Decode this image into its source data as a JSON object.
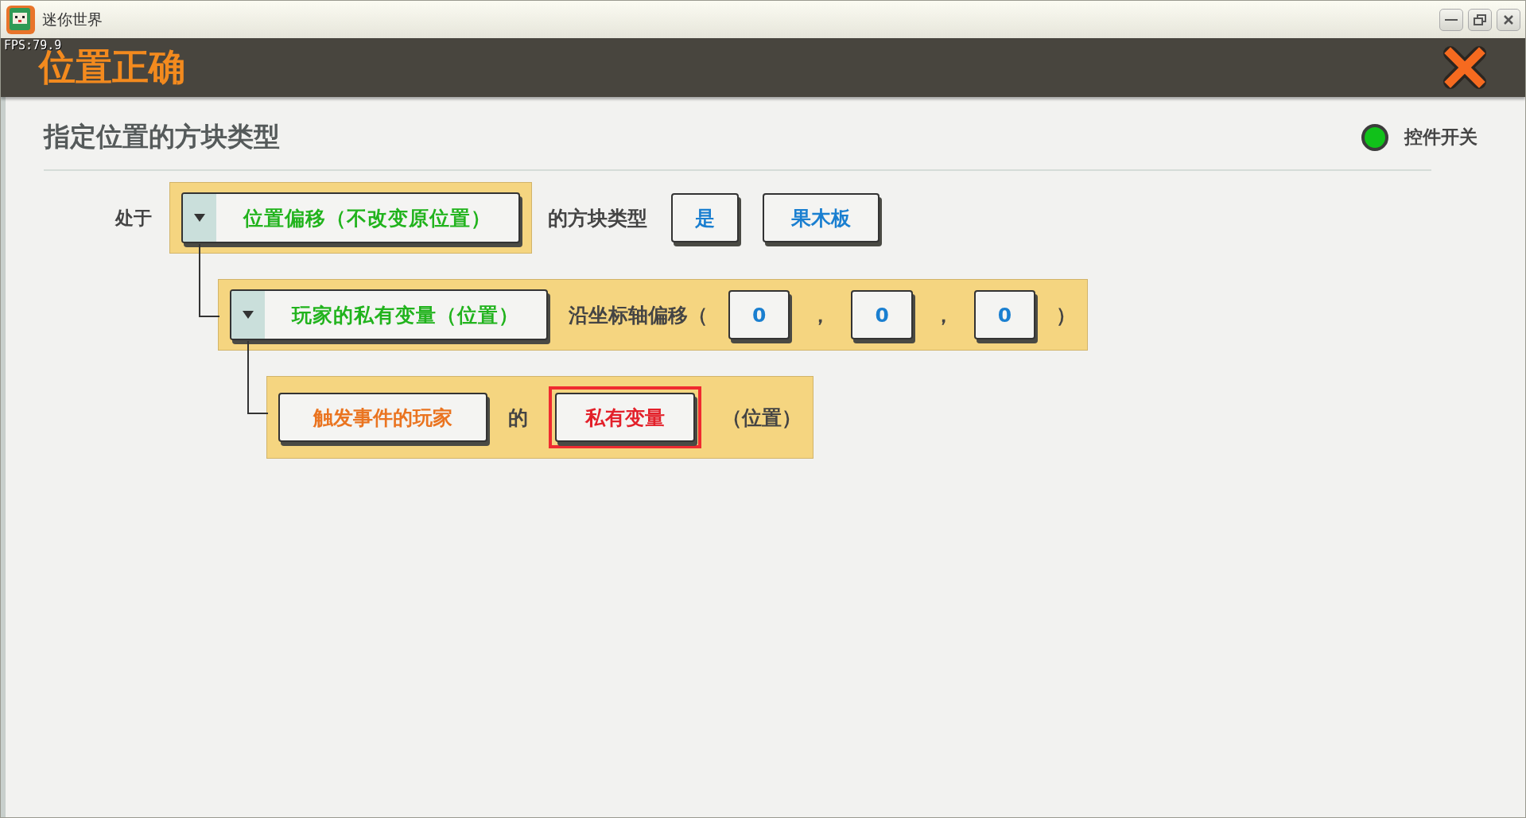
{
  "window": {
    "title": "迷你世界",
    "fps": "FPS:79.9"
  },
  "header": {
    "title": "位置正确"
  },
  "section": {
    "title": "指定位置的方块类型",
    "toggle": {
      "label": "控件开关",
      "on": true
    }
  },
  "statement": {
    "lead": "处于",
    "block": {
      "dropdown": "位置偏移（不改变原位置）",
      "child": {
        "dropdown": "玩家的私有变量（位置）",
        "items": [
          {
            "kind": "text",
            "text": "沿坐标轴偏移（"
          },
          {
            "kind": "value",
            "text": "0"
          },
          {
            "kind": "text",
            "text": "，"
          },
          {
            "kind": "value",
            "text": "0"
          },
          {
            "kind": "text",
            "text": "，"
          },
          {
            "kind": "value",
            "text": "0"
          },
          {
            "kind": "text",
            "text": "）"
          }
        ],
        "child": {
          "items": [
            {
              "kind": "selector",
              "text": "触发事件的玩家"
            },
            {
              "kind": "text",
              "text": "的"
            },
            {
              "kind": "variable",
              "text": "私有变量",
              "selected": true
            },
            {
              "kind": "text",
              "text": "（位置）"
            }
          ]
        }
      }
    },
    "tail": [
      {
        "kind": "text",
        "text": "的方块类型"
      },
      {
        "kind": "value",
        "text": "是"
      },
      {
        "kind": "value",
        "text": "果木板"
      }
    ]
  }
}
